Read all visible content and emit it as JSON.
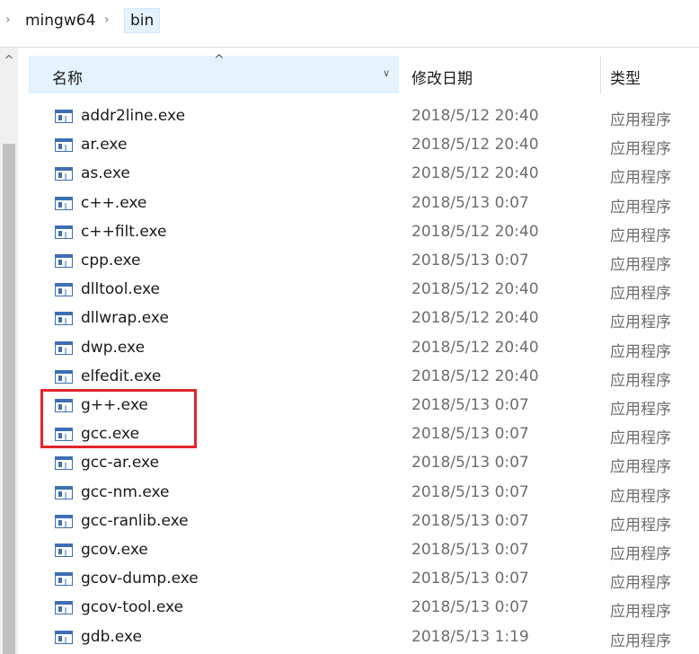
{
  "breadcrumb": {
    "items": [
      {
        "label": "mingw64"
      },
      {
        "label": "bin"
      }
    ],
    "separator": "›"
  },
  "columns": {
    "name": "名称",
    "date": "修改日期",
    "type": "类型"
  },
  "files": [
    {
      "name": "addr2line.exe",
      "date": "2018/5/12 20:40",
      "type": "应用程序"
    },
    {
      "name": "ar.exe",
      "date": "2018/5/12 20:40",
      "type": "应用程序"
    },
    {
      "name": "as.exe",
      "date": "2018/5/12 20:40",
      "type": "应用程序"
    },
    {
      "name": "c++.exe",
      "date": "2018/5/13 0:07",
      "type": "应用程序"
    },
    {
      "name": "c++filt.exe",
      "date": "2018/5/12 20:40",
      "type": "应用程序"
    },
    {
      "name": "cpp.exe",
      "date": "2018/5/13 0:07",
      "type": "应用程序"
    },
    {
      "name": "dlltool.exe",
      "date": "2018/5/12 20:40",
      "type": "应用程序"
    },
    {
      "name": "dllwrap.exe",
      "date": "2018/5/12 20:40",
      "type": "应用程序"
    },
    {
      "name": "dwp.exe",
      "date": "2018/5/12 20:40",
      "type": "应用程序"
    },
    {
      "name": "elfedit.exe",
      "date": "2018/5/12 20:40",
      "type": "应用程序"
    },
    {
      "name": "g++.exe",
      "date": "2018/5/13 0:07",
      "type": "应用程序"
    },
    {
      "name": "gcc.exe",
      "date": "2018/5/13 0:07",
      "type": "应用程序"
    },
    {
      "name": "gcc-ar.exe",
      "date": "2018/5/13 0:07",
      "type": "应用程序"
    },
    {
      "name": "gcc-nm.exe",
      "date": "2018/5/13 0:07",
      "type": "应用程序"
    },
    {
      "name": "gcc-ranlib.exe",
      "date": "2018/5/13 0:07",
      "type": "应用程序"
    },
    {
      "name": "gcov.exe",
      "date": "2018/5/13 0:07",
      "type": "应用程序"
    },
    {
      "name": "gcov-dump.exe",
      "date": "2018/5/13 0:07",
      "type": "应用程序"
    },
    {
      "name": "gcov-tool.exe",
      "date": "2018/5/13 0:07",
      "type": "应用程序"
    },
    {
      "name": "gdb.exe",
      "date": "2018/5/13 1:19",
      "type": "应用程序"
    }
  ],
  "colors": {
    "header_highlight": "#e5f3ff",
    "annotation_box": "#e0262b",
    "icon_blue": "#3d6fb3"
  },
  "icons": {
    "file": "exe-file-icon",
    "sort": "sort-ascending-icon",
    "column_menu": "chevron-down-icon"
  }
}
